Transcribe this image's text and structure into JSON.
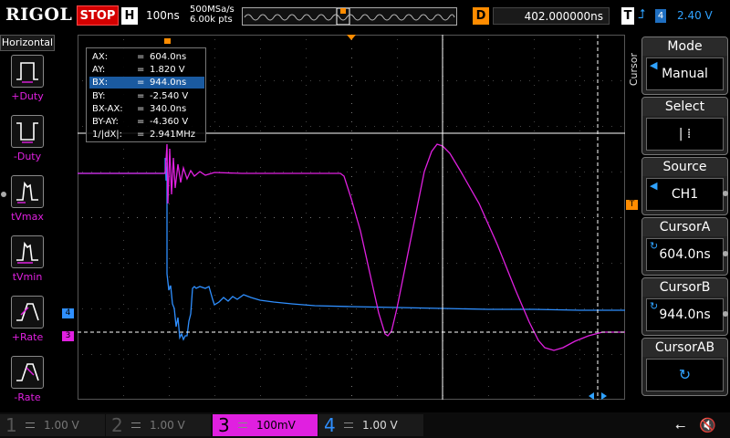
{
  "topbar": {
    "brand": "RIGOL",
    "run_state": "STOP",
    "timebase_label": "H",
    "timebase_value": "100ns",
    "sample_rate": "500MSa/s",
    "memory_depth": "6.00k pts",
    "delay_label": "D",
    "delay_value": "402.000000ns",
    "trigger_label": "T",
    "trigger_source": "4",
    "trigger_level": "2.40 V"
  },
  "left_panel": {
    "title": "Horizontal",
    "items": [
      {
        "label": "+Duty",
        "icon": "positive-duty-icon"
      },
      {
        "label": "-Duty",
        "icon": "negative-duty-icon"
      },
      {
        "label": "tVmax",
        "icon": "time-at-vmax-icon"
      },
      {
        "label": "tVmin",
        "icon": "time-at-vmin-icon"
      },
      {
        "label": "+Rate",
        "icon": "rise-rate-icon"
      },
      {
        "label": "-Rate",
        "icon": "fall-rate-icon"
      }
    ]
  },
  "cursor_info": {
    "rows": [
      {
        "name": "AX:",
        "value": "604.0ns"
      },
      {
        "name": "AY:",
        "value": "1.820 V"
      },
      {
        "name": "BX:",
        "value": "944.0ns"
      },
      {
        "name": "BY:",
        "value": "-2.540 V"
      },
      {
        "name": "BX-AX:",
        "value": "340.0ns"
      },
      {
        "name": "BY-AY:",
        "value": "-4.360 V"
      },
      {
        "name": "1/|dX|:",
        "value": "2.941MHz"
      }
    ],
    "eq": "="
  },
  "right_menu": {
    "vertical_title": "Cursor",
    "mode": {
      "title": "Mode",
      "value": "Manual"
    },
    "select": {
      "title": "Select",
      "value": "|  ⁞"
    },
    "source": {
      "title": "Source",
      "value": "CH1"
    },
    "cursor_a": {
      "title": "CursorA",
      "value": "604.0ns"
    },
    "cursor_b": {
      "title": "CursorB",
      "value": "944.0ns"
    },
    "cursor_ab": {
      "title": "CursorAB",
      "value": ""
    }
  },
  "channels": [
    {
      "num": "1",
      "scale": "1.00 V",
      "color": "#e5d200",
      "active": false
    },
    {
      "num": "2",
      "scale": "1.00 V",
      "color": "#00c0c0",
      "active": false
    },
    {
      "num": "3",
      "scale": "100mV",
      "color": "#e020e0",
      "active": true
    },
    {
      "num": "4",
      "scale": "1.00 V",
      "color": "#2f8fff",
      "active": false
    }
  ],
  "markers": {
    "ch4": "4",
    "ch3": "3"
  },
  "colors": {
    "ch3": "#e020e0",
    "ch4": "#2f8fff",
    "trigger": "#ff8c00"
  }
}
